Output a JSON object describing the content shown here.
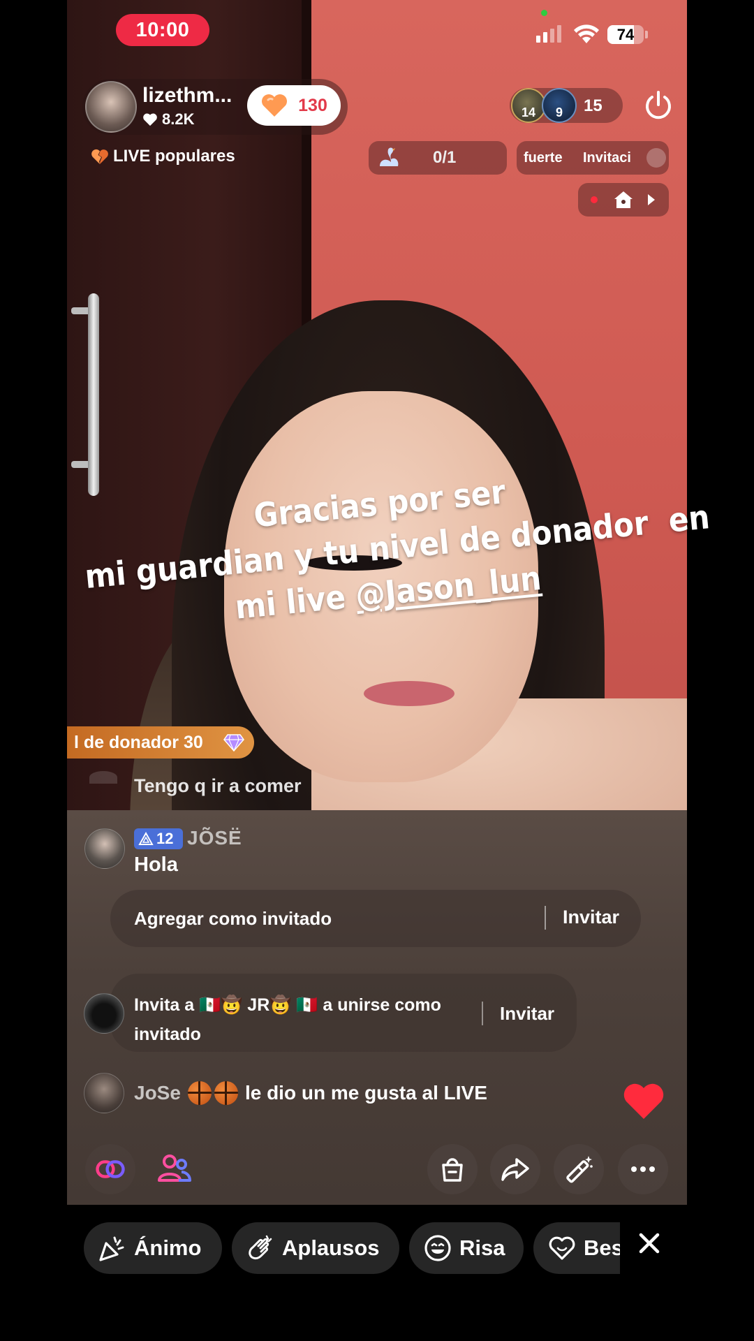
{
  "status_bar": {
    "time": "10:00",
    "battery": "74",
    "battery_fraction": 0.74,
    "signal_bars_filled": 2
  },
  "host": {
    "username": "lizethm...",
    "likes": "8.2K",
    "follow_count": "130",
    "follow_color": "#e23a4a"
  },
  "popular_label": "LIVE populares",
  "viewers": {
    "avatar_levels": [
      "14",
      "9"
    ],
    "count": "15"
  },
  "goal": {
    "progress": "0/1"
  },
  "tabs": [
    "fuerte",
    "Invitaci"
  ],
  "sticker": {
    "line1": "Gracias por ser",
    "line2": "mi guardian y tu nivel de donador  en",
    "line3_prefix": "mi live ",
    "mention": "@Jason_lun"
  },
  "comments": {
    "donor_badge": "l de donador 30",
    "faded_comment": "Tengo q ir a comer",
    "comment1": {
      "level": "12",
      "user": "JÕSË",
      "text": "Hola"
    },
    "guest_prompt": {
      "label": "Agregar como invitado",
      "button": "Invitar"
    },
    "invite_prompt": {
      "line1": "Invita a 🇲🇽🤠 JR🤠 🇲🇽 a unirse como",
      "line2": "invitado",
      "button": "Invitar"
    },
    "like_notice": {
      "user": "JoSe",
      "text": "le dio un me gusta al LIVE"
    }
  },
  "toolbar": {
    "icons": [
      "link-icon",
      "guests-icon",
      "shop-bag-icon",
      "share-icon",
      "magic-wand-icon",
      "more-icon"
    ]
  },
  "reactions": {
    "chips": [
      "Ánimo",
      "Aplausos",
      "Risa",
      "Bes"
    ]
  },
  "colors": {
    "live_red": "#ee2a45",
    "level_blue": "#4a6fd8",
    "donor_orange": "#e09443",
    "heart_red": "#ff2b3d"
  }
}
